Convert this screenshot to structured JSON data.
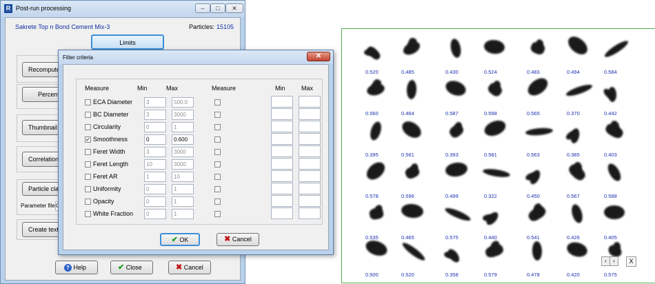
{
  "main_window": {
    "title": "Post-run processing",
    "sample_name": "Sakrete Top n Bond Cement Mix-3",
    "particles_label": "Particles:",
    "particles_count": "15105",
    "limits_label": "Limits",
    "buttons": [
      "Recompute",
      "Percenti",
      "Thumbnail i",
      "Correlation p",
      "Particle cla",
      "Create text"
    ],
    "parameter_file_label": "Parameter file",
    "parameter_file_value": "C",
    "help_label": "Help",
    "close_label": "Close",
    "cancel_label": "Cancel"
  },
  "dialog": {
    "title": "Filter criteria",
    "headers": {
      "measure": "Measure",
      "min": "Min",
      "max": "Max",
      "measure2": "Measure",
      "min2": "Min",
      "max2": "Max"
    },
    "rows": [
      {
        "name": "ECA Diameter",
        "checked": false,
        "min": "3",
        "max": "500.0"
      },
      {
        "name": "BC Diameter",
        "checked": false,
        "min": "3",
        "max": "3000"
      },
      {
        "name": "Circularity",
        "checked": false,
        "min": "0",
        "max": "1"
      },
      {
        "name": "Smoothness",
        "checked": true,
        "min": "0",
        "max": "0.600"
      },
      {
        "name": "Feret Width",
        "checked": false,
        "min": "3",
        "max": "3000"
      },
      {
        "name": "Feret Length",
        "checked": false,
        "min": "10",
        "max": "3000"
      },
      {
        "name": "Feret AR",
        "checked": false,
        "min": "1",
        "max": "10"
      },
      {
        "name": "Uniformity",
        "checked": false,
        "min": "0",
        "max": "1"
      },
      {
        "name": "Opacity",
        "checked": false,
        "min": "0",
        "max": "1"
      },
      {
        "name": "White Fraction",
        "checked": false,
        "min": "0",
        "max": "1"
      }
    ],
    "ok_label": "OK",
    "cancel_label": "Cancel"
  },
  "thumbnails": {
    "values": [
      [
        "0.520",
        "0.485",
        "0.430",
        "0.524",
        "0.483",
        "0.494",
        "0.584"
      ],
      [
        "0.560",
        "0.464",
        "0.587",
        "0.598",
        "0.565",
        "0.370",
        "0.442"
      ],
      [
        "0.395",
        "0.561",
        "0.393",
        "0.581",
        "0.563",
        "0.385",
        "0.403"
      ],
      [
        "0.578",
        "0.596",
        "0.499",
        "0.322",
        "0.450",
        "0.567",
        "0.588"
      ],
      [
        "0.535",
        "0.465",
        "0.575",
        "0.440",
        "0.541",
        "0.426",
        "0.405"
      ],
      [
        "0.500",
        "0.520",
        "0.358",
        "0.579",
        "0.478",
        "0.420",
        "0.575"
      ]
    ],
    "close_label": "X",
    "prev_label": "‹",
    "next_label": "›"
  }
}
